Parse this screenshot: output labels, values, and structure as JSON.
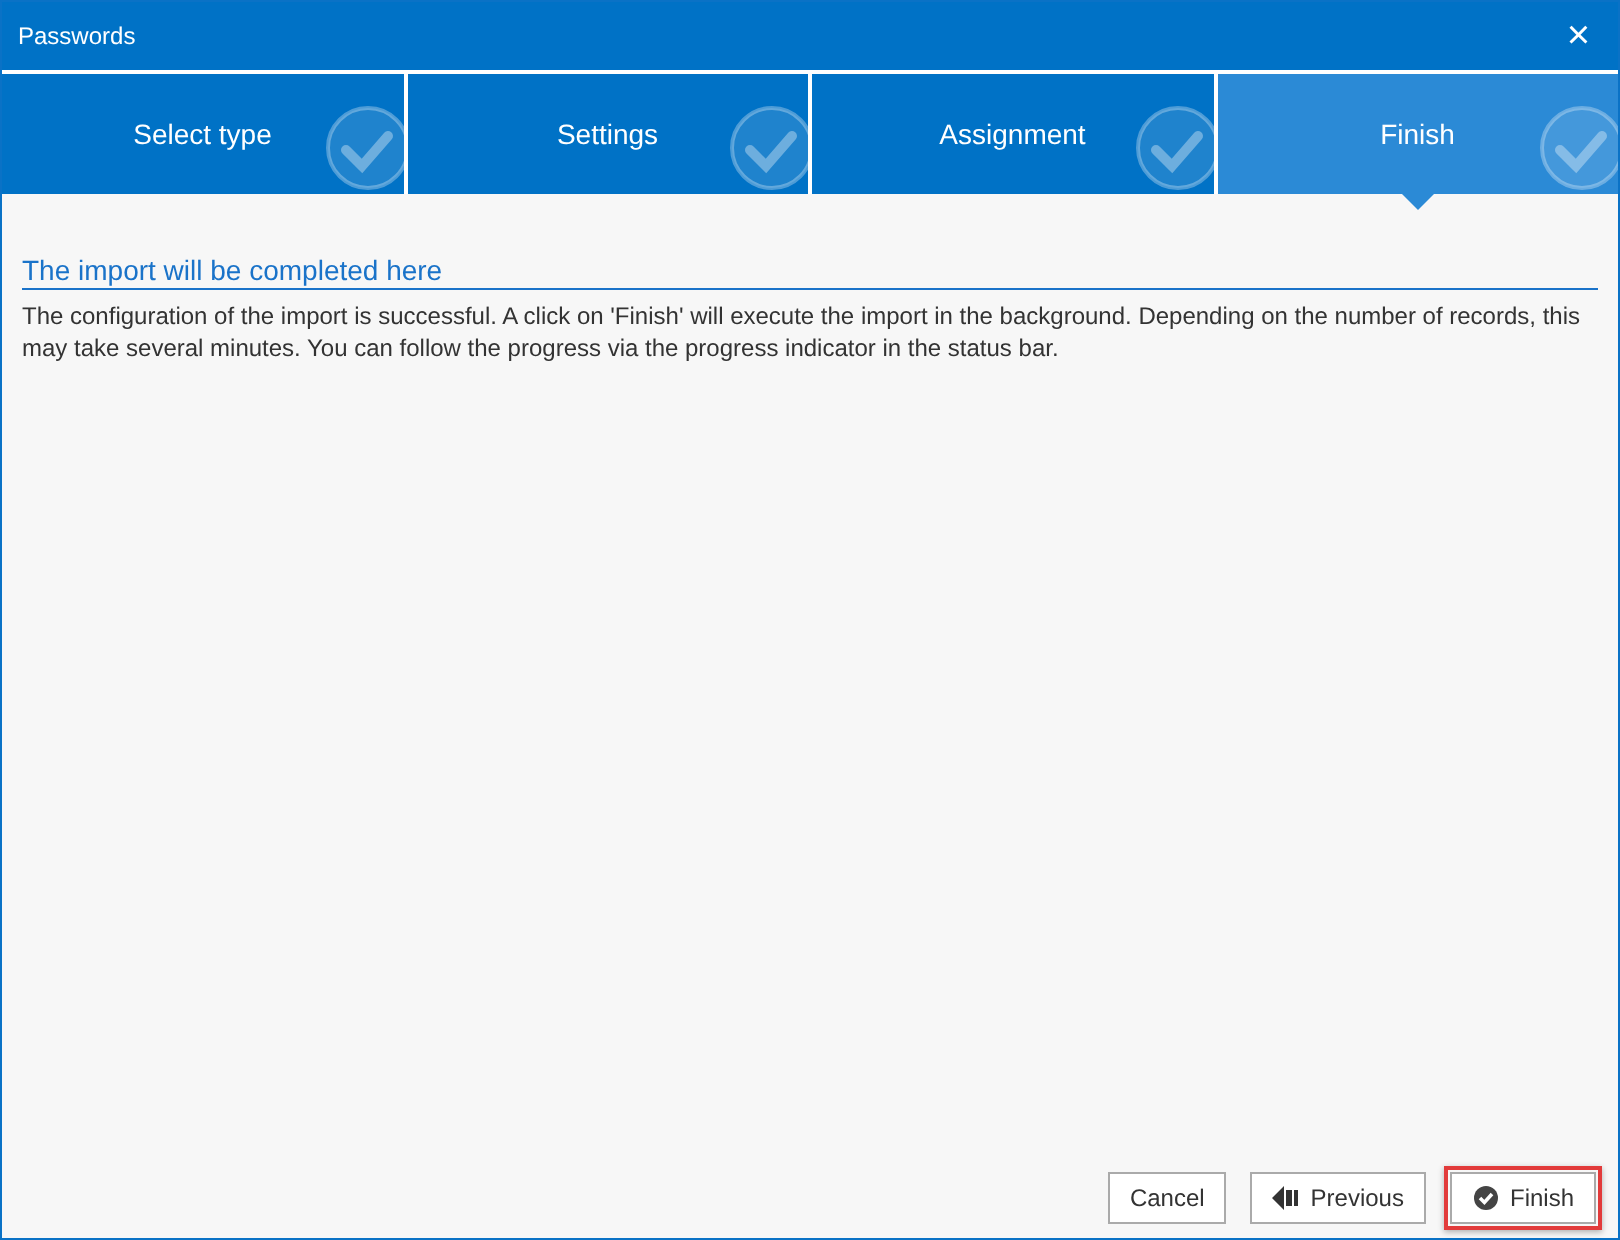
{
  "window": {
    "title": "Passwords",
    "close": "×"
  },
  "steps": [
    {
      "label": "Select type",
      "selected": false,
      "done": true
    },
    {
      "label": "Settings",
      "selected": false,
      "done": true
    },
    {
      "label": "Assignment",
      "selected": false,
      "done": true
    },
    {
      "label": "Finish",
      "selected": true,
      "done": true
    }
  ],
  "heading": "The import will be completed here",
  "description": "The configuration of the import is successful. A click on 'Finish' will execute the import in the background. Depending on the number of records, this may take several minutes. You can follow the progress via the progress indicator in the status bar.",
  "buttons": [
    {
      "kind": "plain",
      "label": "Cancel",
      "highlighted": false
    },
    {
      "kind": "previous",
      "label": "Previous",
      "highlighted": false
    },
    {
      "kind": "finish",
      "label": "Finish",
      "highlighted": true
    }
  ]
}
